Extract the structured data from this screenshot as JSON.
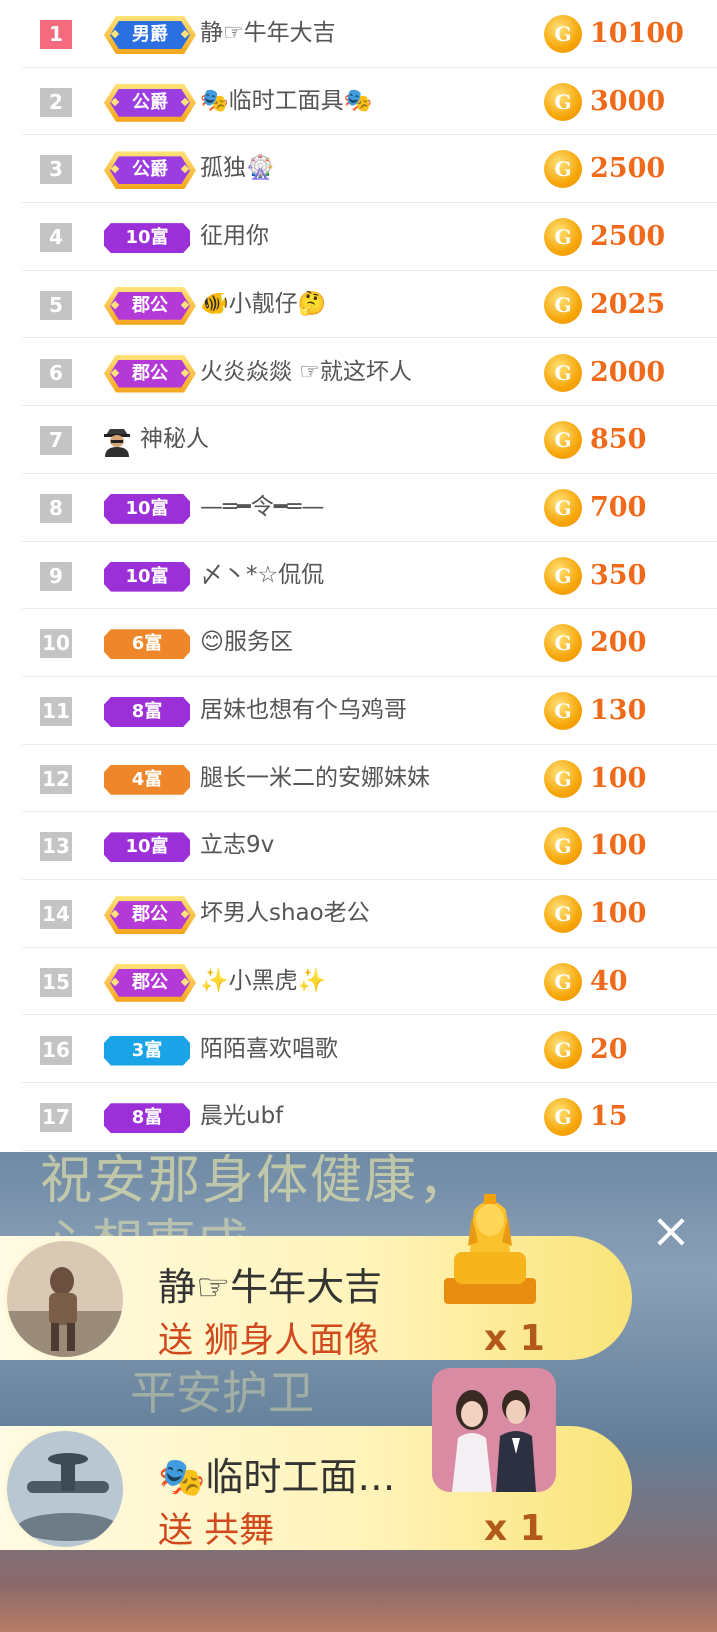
{
  "leaderboard": [
    {
      "rank": "1",
      "badge": "男爵",
      "badge_type": "hex",
      "badge_color": "#2c6fe0",
      "name": "静☞牛年大吉",
      "score": "10100"
    },
    {
      "rank": "2",
      "badge": "公爵",
      "badge_type": "hex",
      "badge_color": "#9a3ee2",
      "name": "🎭临时工面具🎭",
      "score": "3000"
    },
    {
      "rank": "3",
      "badge": "公爵",
      "badge_type": "hex",
      "badge_color": "#9a3ee2",
      "name": "孤独🎡",
      "score": "2500"
    },
    {
      "rank": "4",
      "badge": "10富",
      "badge_type": "rich",
      "badge_color": "#9b30d8",
      "name": "征用你",
      "score": "2500"
    },
    {
      "rank": "5",
      "badge": "郡公",
      "badge_type": "hex",
      "badge_color": "#b43ad8",
      "name": "🐠小靓仔🤔",
      "score": "2025"
    },
    {
      "rank": "6",
      "badge": "郡公",
      "badge_type": "hex",
      "badge_color": "#b43ad8",
      "name": "火炎焱燚 ☞就这坏人",
      "score": "2000"
    },
    {
      "rank": "7",
      "badge": "",
      "badge_type": "mystery",
      "badge_color": "",
      "name": "神秘人",
      "score": "850"
    },
    {
      "rank": "8",
      "badge": "10富",
      "badge_type": "rich",
      "badge_color": "#9b30d8",
      "name": "—═━令━═—",
      "score": "700"
    },
    {
      "rank": "9",
      "badge": "10富",
      "badge_type": "rich",
      "badge_color": "#9b30d8",
      "name": "〆丶*☆侃侃",
      "score": "350"
    },
    {
      "rank": "10",
      "badge": "6富",
      "badge_type": "rich",
      "badge_color": "#f0862a",
      "name": "😊服务区",
      "score": "200"
    },
    {
      "rank": "11",
      "badge": "8富",
      "badge_type": "rich",
      "badge_color": "#9b30d8",
      "name": "居妹也想有个乌鸡哥",
      "score": "130"
    },
    {
      "rank": "12",
      "badge": "4富",
      "badge_type": "rich",
      "badge_color": "#f0862a",
      "name": "腿长一米二的安娜妹妹",
      "score": "100"
    },
    {
      "rank": "13",
      "badge": "10富",
      "badge_type": "rich",
      "badge_color": "#9b30d8",
      "name": "立志9v",
      "score": "100"
    },
    {
      "rank": "14",
      "badge": "郡公",
      "badge_type": "hex",
      "badge_color": "#b43ad8",
      "name": "坏男人shao老公",
      "score": "100"
    },
    {
      "rank": "15",
      "badge": "郡公",
      "badge_type": "hex",
      "badge_color": "#b43ad8",
      "name": "✨小黑虎✨",
      "score": "40"
    },
    {
      "rank": "16",
      "badge": "3富",
      "badge_type": "rich",
      "badge_color": "#1aa3e6",
      "name": "陌陌喜欢唱歌",
      "score": "20"
    },
    {
      "rank": "17",
      "badge": "8富",
      "badge_type": "rich",
      "badge_color": "#9b30d8",
      "name": "晨光ubf",
      "score": "15"
    }
  ],
  "coin_label": "G",
  "video": {
    "caption_line1": "祝安那身体健康，",
    "caption_line2": "心想事成",
    "caption_line3": "平安护卫",
    "close_label": "×"
  },
  "gifts": [
    {
      "sender": "静☞牛年大吉",
      "action": "送 狮身人面像",
      "count": "x 1"
    },
    {
      "sender": "🎭临时工面…",
      "action": "送 共舞",
      "count": "x 1"
    }
  ],
  "colors": {
    "accent": "#ef6b1b",
    "rank_first": "#f46b7e",
    "rank_other": "#c4c4c4"
  }
}
